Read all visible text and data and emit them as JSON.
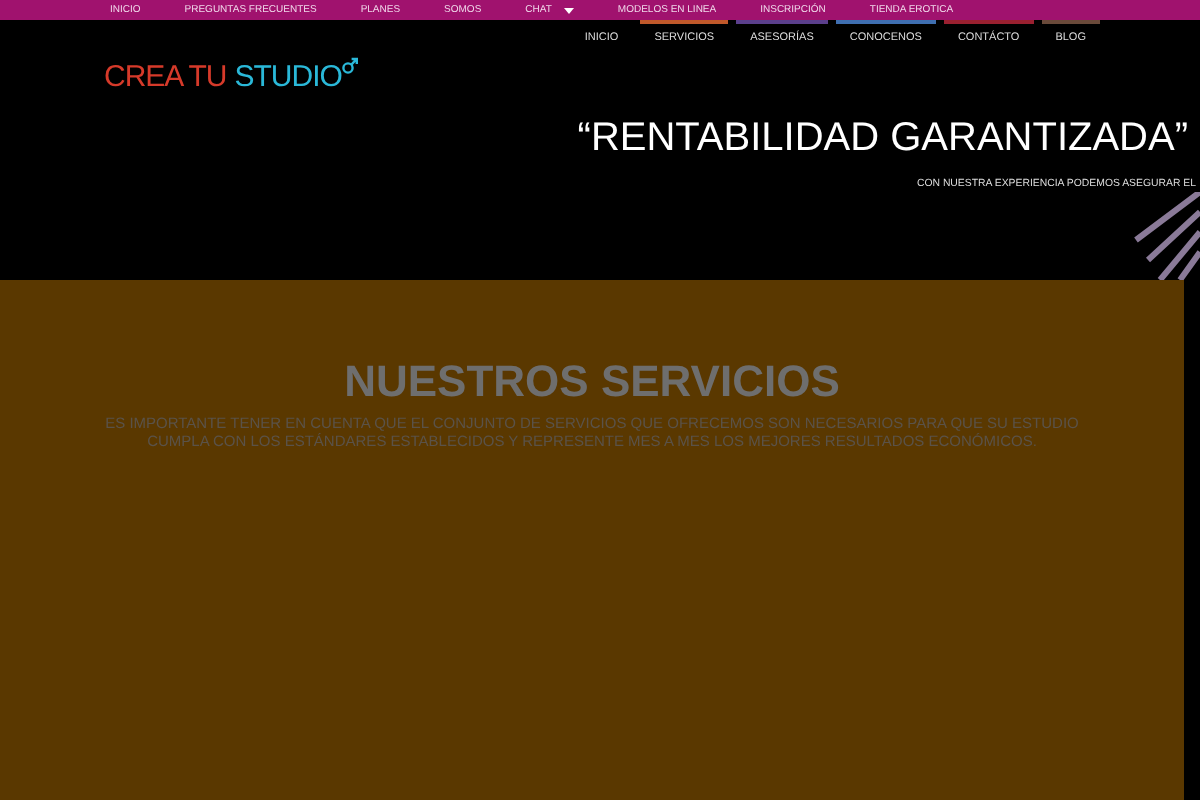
{
  "top_menu": [
    {
      "label": "INICIO",
      "dropdown": false
    },
    {
      "label": "PREGUNTAS FRECUENTES",
      "dropdown": false
    },
    {
      "label": "PLANES",
      "dropdown": false
    },
    {
      "label": "SOMOS",
      "dropdown": false
    },
    {
      "label": "CHAT",
      "dropdown": true
    },
    {
      "label": "MODELOS EN LINEA",
      "dropdown": false
    },
    {
      "label": "INSCRIPCIÓN",
      "dropdown": false
    },
    {
      "label": "TIENDA EROTICA",
      "dropdown": false
    }
  ],
  "logo": {
    "part_1": "CREA TU",
    "part_2": "STUDIO"
  },
  "main_menu": [
    {
      "label": "INICIO"
    },
    {
      "label": "SERVICIOS",
      "color": "#c0582a"
    },
    {
      "label": "ASESORÍAS",
      "color": "#5b3f8c"
    },
    {
      "label": "CONOCENOS",
      "color": "#3f6fb0"
    },
    {
      "label": "CONTÁCTO",
      "color": "#9a2030"
    },
    {
      "label": "BLOG",
      "color": "#6a4a3a"
    }
  ],
  "hero": {
    "title": "“RENTABILIDAD GARANTIZADA”",
    "subtitle": "CON NUESTRA EXPERIENCIA PODEMOS ASEGURAR EL"
  },
  "services": {
    "heading": "NUESTROS SERVICIOS",
    "text": "ES IMPORTANTE TENER EN CUENTA QUE EL CONJUNTO DE SERVICIOS QUE OFRECEMOS SON NECESARIOS PARA QUE SU ESTUDIO CUMPLA CON LOS ESTÁNDARES ESTABLECIDOS Y REPRESENTE MES A MES LOS MEJORES RESULTADOS ECONÓMICOS."
  }
}
